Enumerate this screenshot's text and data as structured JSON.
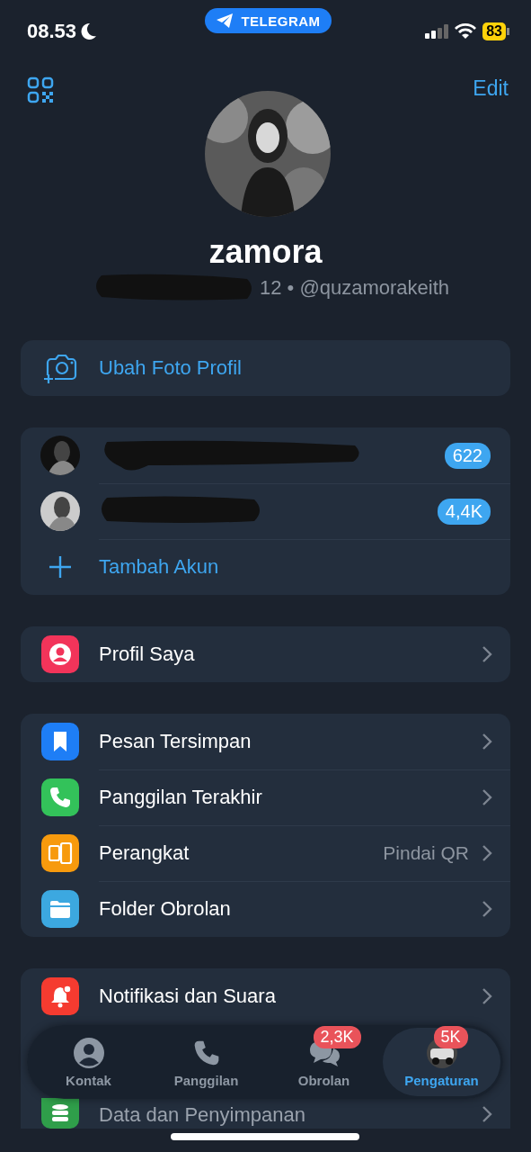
{
  "status_bar": {
    "time": "08.53",
    "app_pill": "TELEGRAM",
    "battery": "83"
  },
  "header": {
    "edit": "Edit"
  },
  "profile": {
    "kind": "picture",
    "name": "zamora",
    "subtitle": "12 • @quzamorakeith"
  },
  "change_photo": {
    "label": "Ubah Foto Profil"
  },
  "accounts": [
    {
      "kind": "picture",
      "badge": "622"
    },
    {
      "kind": "picture",
      "badge": "4,4K"
    }
  ],
  "add_account": {
    "label": "Tambah Akun"
  },
  "groups": [
    [
      {
        "kind": "profile",
        "color": "#f2345a",
        "label": "Profil Saya"
      }
    ],
    [
      {
        "kind": "saved",
        "color": "#1e7ef6",
        "label": "Pesan Tersimpan"
      },
      {
        "kind": "call",
        "color": "#33c25a",
        "label": "Panggilan Terakhir"
      },
      {
        "kind": "devices",
        "color": "#f79a0d",
        "label": "Perangkat",
        "value": "Pindai QR"
      },
      {
        "kind": "folder",
        "color": "#3ca8e0",
        "label": "Folder Obrolan"
      }
    ],
    [
      {
        "kind": "bell",
        "color": "#f53b30",
        "label": "Notifikasi dan Suara"
      },
      {
        "kind": "data",
        "color": "#2f9e4a",
        "label": "Data dan Penyimpanan"
      }
    ]
  ],
  "tabs": [
    {
      "kind": "contact",
      "label": "Kontak",
      "selected": false
    },
    {
      "kind": "phone",
      "label": "Panggilan",
      "selected": false
    },
    {
      "kind": "chats",
      "label": "Obrolan",
      "badge": "2,3K",
      "selected": false
    },
    {
      "kind": "avatar",
      "label": "Pengaturan",
      "badge": "5K",
      "selected": true
    }
  ]
}
